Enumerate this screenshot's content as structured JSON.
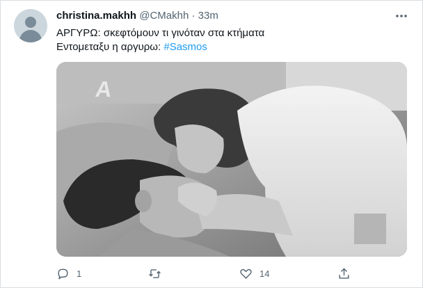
{
  "tweet": {
    "display_name": "christina.makhh",
    "handle": "@CMakhh",
    "separator": "·",
    "time": "33m",
    "text_lines": [
      "ΑΡΓΥΡΩ: σκεφτόμουν τι γινόταν στα κτήματα",
      "Εντομεταξυ η αργυρω: "
    ],
    "hashtag": "#Sasmos",
    "media": {
      "channel_logo_text": "A",
      "description_icon": "photo-still"
    },
    "actions": {
      "reply_count": "1",
      "retweet_count": "",
      "like_count": "14",
      "share_count": ""
    }
  },
  "colors": {
    "link": "#1d9bf0",
    "secondary_text": "#536471",
    "primary_text": "#0f1419",
    "border": "#d9dee2"
  }
}
